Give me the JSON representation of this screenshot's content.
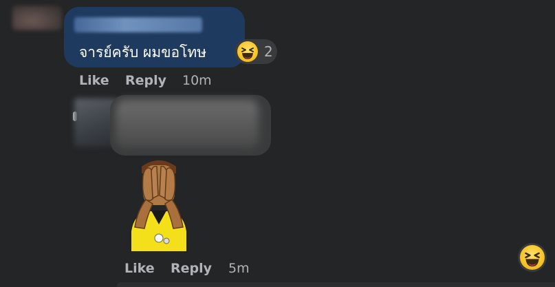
{
  "comment1": {
    "text": "จารย์ครับ ผมขอโทษ",
    "reaction_count": "2",
    "actions": {
      "like": "Like",
      "reply": "Reply",
      "time": "10m"
    }
  },
  "comment2": {
    "actions": {
      "like": "Like",
      "reply": "Reply",
      "time": "5m"
    }
  },
  "icons": {
    "reaction": "laughing-face-icon",
    "sticker": "facepalm-sticker"
  },
  "colors": {
    "background": "#242526",
    "bubble_highlight": "#1f3a5f",
    "bubble_default": "#3a3b3c",
    "secondary_text": "#b0b3b8"
  }
}
